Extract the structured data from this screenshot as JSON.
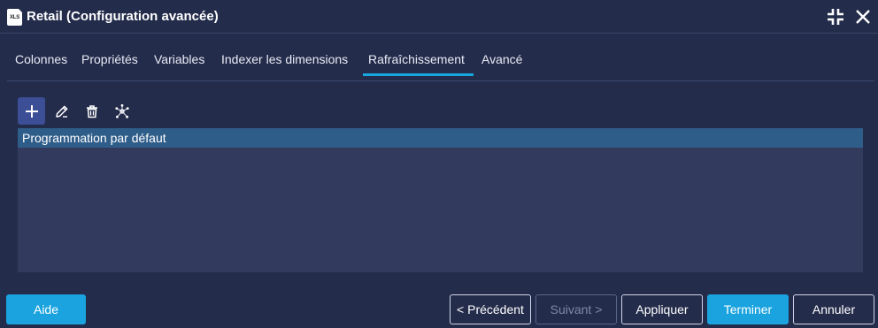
{
  "window": {
    "title": "Retail (Configuration avancée)",
    "app_icon_text": "XLS"
  },
  "tabs": [
    {
      "label": "Colonnes",
      "active": false
    },
    {
      "label": "Propriétés",
      "active": false
    },
    {
      "label": "Variables",
      "active": false
    },
    {
      "label": "Indexer les dimensions",
      "active": false
    },
    {
      "label": "Rafraîchissement",
      "active": true
    },
    {
      "label": "Avancé",
      "active": false
    }
  ],
  "toolbar": {
    "icons": [
      "plus-icon",
      "edit-icon",
      "trash-icon",
      "network-icon"
    ]
  },
  "schedule_list": {
    "items": [
      "Programmation par défaut"
    ],
    "selected_index": 0
  },
  "footer": {
    "help_label": "Aide",
    "previous_label": "< Précédent",
    "next_label": "Suivant >",
    "apply_label": "Appliquer",
    "finish_label": "Terminer",
    "cancel_label": "Annuler"
  },
  "colors": {
    "background": "#242c4b",
    "accent": "#1aa3df",
    "selection": "#2f5d8a",
    "list_background": "#323b5e"
  }
}
